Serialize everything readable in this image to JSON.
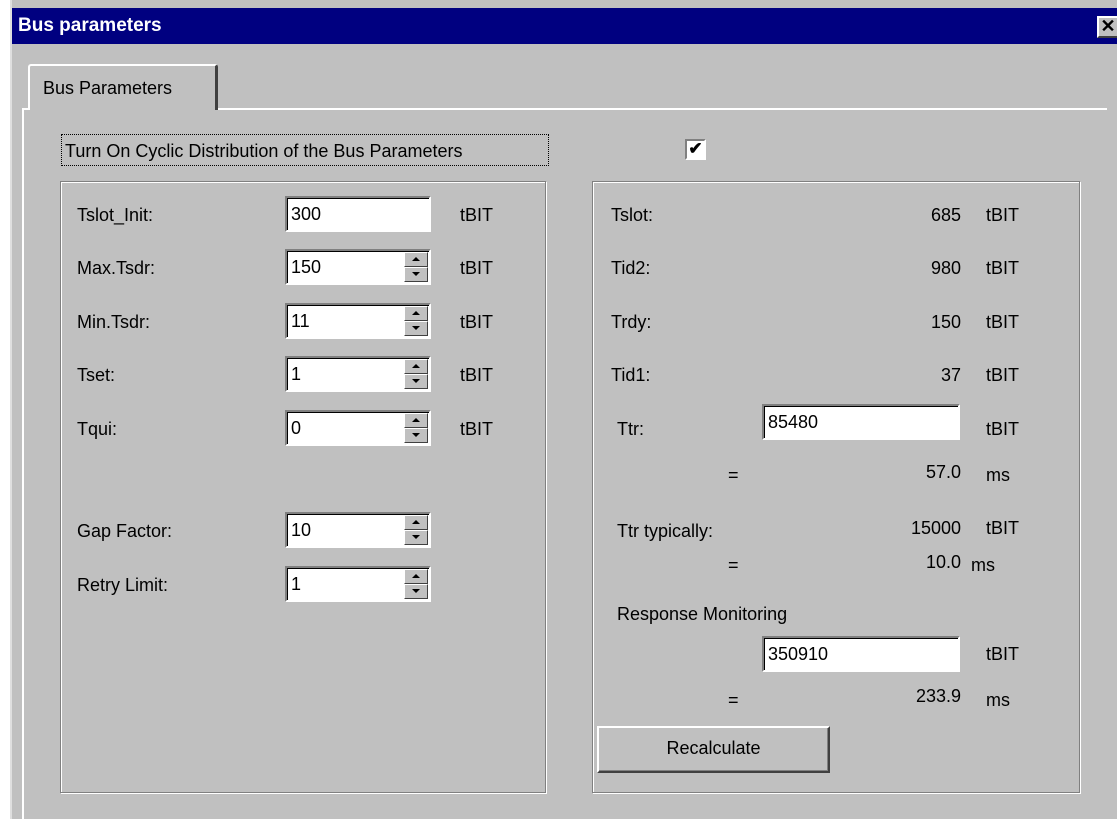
{
  "window": {
    "title": "Bus parameters",
    "close_glyph": "✕"
  },
  "tabs": [
    {
      "label": "Bus Parameters"
    }
  ],
  "cyclic": {
    "label": "Turn On Cyclic Distribution of the Bus Parameters",
    "checked_glyph": "✔"
  },
  "left": {
    "tslot_init": {
      "label": "Tslot_Init:",
      "value": "300",
      "unit": "tBIT"
    },
    "max_tsdr": {
      "label": "Max.Tsdr:",
      "value": "150",
      "unit": "tBIT"
    },
    "min_tsdr": {
      "label": "Min.Tsdr:",
      "value": "11",
      "unit": "tBIT"
    },
    "tset": {
      "label": "Tset:",
      "value": "1",
      "unit": "tBIT"
    },
    "tqui": {
      "label": "Tqui:",
      "value": "0",
      "unit": "tBIT"
    },
    "gap_factor": {
      "label": "Gap Factor:",
      "value": "10"
    },
    "retry_limit": {
      "label": "Retry Limit:",
      "value": "1"
    }
  },
  "right": {
    "tslot": {
      "label": "Tslot:",
      "value": "685",
      "unit": "tBIT"
    },
    "tid2": {
      "label": "Tid2:",
      "value": "980",
      "unit": "tBIT"
    },
    "trdy": {
      "label": "Trdy:",
      "value": "150",
      "unit": "tBIT"
    },
    "tid1": {
      "label": "Tid1:",
      "value": "37",
      "unit": "tBIT"
    },
    "ttr": {
      "label": "Ttr:",
      "value": "85480",
      "unit": "tBIT",
      "eq": "=",
      "ms_value": "57.0",
      "ms_unit": "ms"
    },
    "ttr_typ": {
      "label": "Ttr typically:",
      "value": "15000",
      "unit": "tBIT",
      "eq": "=",
      "ms_value": "10.0",
      "ms_unit": "ms"
    },
    "response": {
      "label": "Response Monitoring",
      "value": "350910",
      "unit": "tBIT",
      "eq": "=",
      "ms_value": "233.9",
      "ms_unit": "ms"
    }
  },
  "buttons": {
    "recalculate": "Recalculate"
  }
}
